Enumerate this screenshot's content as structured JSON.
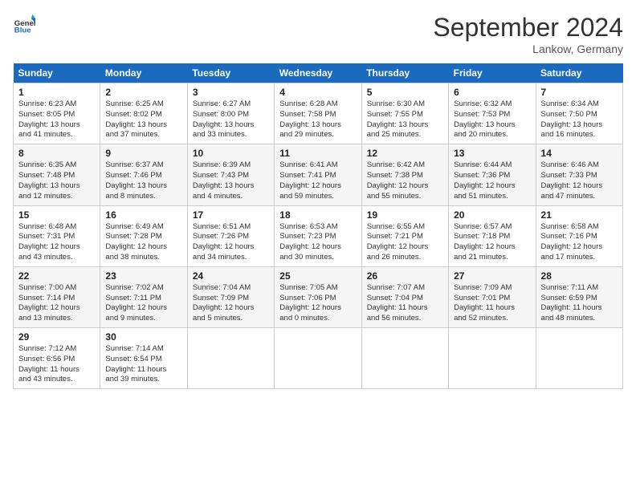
{
  "header": {
    "logo_text_general": "General",
    "logo_text_blue": "Blue",
    "month_title": "September 2024",
    "location": "Lankow, Germany"
  },
  "weekdays": [
    "Sunday",
    "Monday",
    "Tuesday",
    "Wednesday",
    "Thursday",
    "Friday",
    "Saturday"
  ],
  "weeks": [
    [
      {
        "day": "1",
        "sunrise": "6:23 AM",
        "sunset": "8:05 PM",
        "daylight": "13 hours and 41 minutes."
      },
      {
        "day": "2",
        "sunrise": "6:25 AM",
        "sunset": "8:02 PM",
        "daylight": "13 hours and 37 minutes."
      },
      {
        "day": "3",
        "sunrise": "6:27 AM",
        "sunset": "8:00 PM",
        "daylight": "13 hours and 33 minutes."
      },
      {
        "day": "4",
        "sunrise": "6:28 AM",
        "sunset": "7:58 PM",
        "daylight": "13 hours and 29 minutes."
      },
      {
        "day": "5",
        "sunrise": "6:30 AM",
        "sunset": "7:55 PM",
        "daylight": "13 hours and 25 minutes."
      },
      {
        "day": "6",
        "sunrise": "6:32 AM",
        "sunset": "7:53 PM",
        "daylight": "13 hours and 20 minutes."
      },
      {
        "day": "7",
        "sunrise": "6:34 AM",
        "sunset": "7:50 PM",
        "daylight": "13 hours and 16 minutes."
      }
    ],
    [
      {
        "day": "8",
        "sunrise": "6:35 AM",
        "sunset": "7:48 PM",
        "daylight": "13 hours and 12 minutes."
      },
      {
        "day": "9",
        "sunrise": "6:37 AM",
        "sunset": "7:46 PM",
        "daylight": "13 hours and 8 minutes."
      },
      {
        "day": "10",
        "sunrise": "6:39 AM",
        "sunset": "7:43 PM",
        "daylight": "13 hours and 4 minutes."
      },
      {
        "day": "11",
        "sunrise": "6:41 AM",
        "sunset": "7:41 PM",
        "daylight": "12 hours and 59 minutes."
      },
      {
        "day": "12",
        "sunrise": "6:42 AM",
        "sunset": "7:38 PM",
        "daylight": "12 hours and 55 minutes."
      },
      {
        "day": "13",
        "sunrise": "6:44 AM",
        "sunset": "7:36 PM",
        "daylight": "12 hours and 51 minutes."
      },
      {
        "day": "14",
        "sunrise": "6:46 AM",
        "sunset": "7:33 PM",
        "daylight": "12 hours and 47 minutes."
      }
    ],
    [
      {
        "day": "15",
        "sunrise": "6:48 AM",
        "sunset": "7:31 PM",
        "daylight": "12 hours and 43 minutes."
      },
      {
        "day": "16",
        "sunrise": "6:49 AM",
        "sunset": "7:28 PM",
        "daylight": "12 hours and 38 minutes."
      },
      {
        "day": "17",
        "sunrise": "6:51 AM",
        "sunset": "7:26 PM",
        "daylight": "12 hours and 34 minutes."
      },
      {
        "day": "18",
        "sunrise": "6:53 AM",
        "sunset": "7:23 PM",
        "daylight": "12 hours and 30 minutes."
      },
      {
        "day": "19",
        "sunrise": "6:55 AM",
        "sunset": "7:21 PM",
        "daylight": "12 hours and 26 minutes."
      },
      {
        "day": "20",
        "sunrise": "6:57 AM",
        "sunset": "7:18 PM",
        "daylight": "12 hours and 21 minutes."
      },
      {
        "day": "21",
        "sunrise": "6:58 AM",
        "sunset": "7:16 PM",
        "daylight": "12 hours and 17 minutes."
      }
    ],
    [
      {
        "day": "22",
        "sunrise": "7:00 AM",
        "sunset": "7:14 PM",
        "daylight": "12 hours and 13 minutes."
      },
      {
        "day": "23",
        "sunrise": "7:02 AM",
        "sunset": "7:11 PM",
        "daylight": "12 hours and 9 minutes."
      },
      {
        "day": "24",
        "sunrise": "7:04 AM",
        "sunset": "7:09 PM",
        "daylight": "12 hours and 5 minutes."
      },
      {
        "day": "25",
        "sunrise": "7:05 AM",
        "sunset": "7:06 PM",
        "daylight": "12 hours and 0 minutes."
      },
      {
        "day": "26",
        "sunrise": "7:07 AM",
        "sunset": "7:04 PM",
        "daylight": "11 hours and 56 minutes."
      },
      {
        "day": "27",
        "sunrise": "7:09 AM",
        "sunset": "7:01 PM",
        "daylight": "11 hours and 52 minutes."
      },
      {
        "day": "28",
        "sunrise": "7:11 AM",
        "sunset": "6:59 PM",
        "daylight": "11 hours and 48 minutes."
      }
    ],
    [
      {
        "day": "29",
        "sunrise": "7:12 AM",
        "sunset": "6:56 PM",
        "daylight": "11 hours and 43 minutes."
      },
      {
        "day": "30",
        "sunrise": "7:14 AM",
        "sunset": "6:54 PM",
        "daylight": "11 hours and 39 minutes."
      },
      null,
      null,
      null,
      null,
      null
    ]
  ],
  "labels": {
    "sunrise": "Sunrise:",
    "sunset": "Sunset:",
    "daylight": "Daylight:"
  }
}
